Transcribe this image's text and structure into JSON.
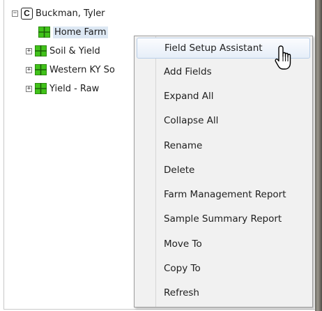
{
  "tree": {
    "root": {
      "label": "Buckman, Tyler",
      "icon": "client-icon",
      "expander": "−"
    },
    "items": [
      {
        "label": "Home Farm",
        "icon": "field-grid-icon",
        "selected": true
      },
      {
        "label": "Soil & Yield",
        "icon": "field-grid-icon",
        "expander": "+"
      },
      {
        "label": "Western KY So",
        "icon": "field-grid-icon",
        "expander": "+"
      },
      {
        "label": "Yield - Raw",
        "icon": "field-grid-icon",
        "expander": "+"
      }
    ]
  },
  "context_menu": {
    "items": [
      {
        "label": "Field Setup Assistant",
        "hovered": true
      },
      {
        "label": "Add Fields"
      },
      {
        "label": "Expand All"
      },
      {
        "label": "Collapse All"
      },
      {
        "label": "Rename"
      },
      {
        "label": "Delete"
      },
      {
        "label": "Farm Management Report"
      },
      {
        "label": "Sample Summary Report"
      },
      {
        "label": "Move To"
      },
      {
        "label": "Copy To"
      },
      {
        "label": "Refresh"
      }
    ]
  },
  "colors": {
    "field_icon_green": "#41c21a",
    "hover_border": "#b9cfe8"
  },
  "cursor": "hand-pointer-icon"
}
